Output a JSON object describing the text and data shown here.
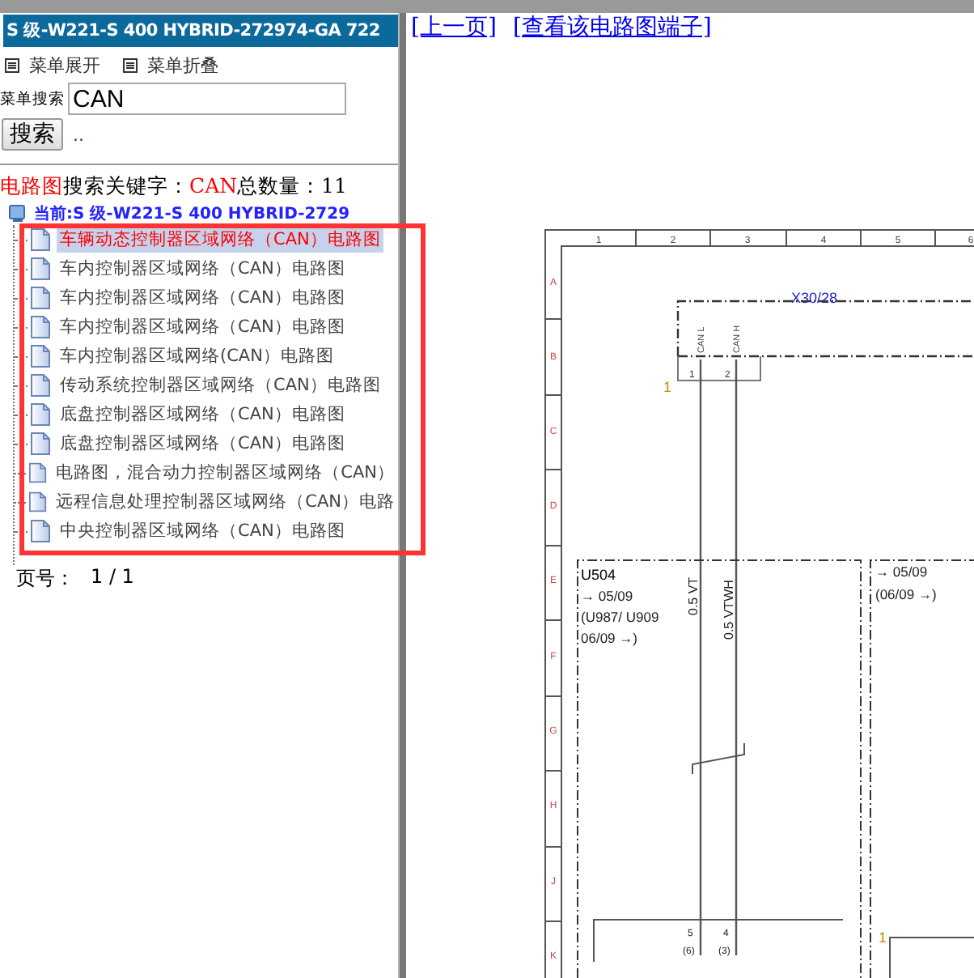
{
  "title_bar": {
    "title": "S 级-W221-S 400 HYBRID-272974-GA 722"
  },
  "menu_toggles": [
    {
      "label": "菜单展开"
    },
    {
      "label": "菜单折叠"
    }
  ],
  "search": {
    "label": "菜单搜索",
    "value": "CAN",
    "button": "搜索",
    "extra": ".."
  },
  "result_summary": {
    "category": "电路图",
    "keyword_label": "搜索关键字：",
    "keyword": "CAN",
    "count_label": "总数量：",
    "count": "11"
  },
  "tree": {
    "label": "当前:S 级-W221-S 400 HYBRID-2729",
    "children": [
      {
        "label": "车辆动态控制器区域网络（CAN）电路图",
        "selected": true
      },
      {
        "label": "车内控制器区域网络（CAN）电路图",
        "selected": false
      },
      {
        "label": "车内控制器区域网络（CAN）电路图",
        "selected": false
      },
      {
        "label": "车内控制器区域网络（CAN）电路图",
        "selected": false
      },
      {
        "label": "车内控制器区域网络(CAN）电路图",
        "selected": false
      },
      {
        "label": "传动系统控制器区域网络（CAN）电路图",
        "selected": false
      },
      {
        "label": "底盘控制器区域网络（CAN）电路图",
        "selected": false
      },
      {
        "label": "底盘控制器区域网络（CAN）电路图",
        "selected": false
      },
      {
        "label": "电路图，混合动力控制器区域网络（CAN）",
        "selected": false
      },
      {
        "label": "远程信息处理控制器区域网络（CAN）电路",
        "selected": false
      },
      {
        "label": "中央控制器区域网络（CAN）电路图",
        "selected": false
      }
    ]
  },
  "pager": {
    "label": "页号：",
    "value": "1 / 1"
  },
  "nav_links": [
    {
      "label": "[上一页]"
    },
    {
      "label": "[查看该电路图端子]"
    }
  ],
  "diagram": {
    "column_labels": [
      "1",
      "2",
      "3",
      "4",
      "5",
      "6"
    ],
    "row_labels": [
      "A",
      "B",
      "C",
      "D",
      "E",
      "F",
      "G",
      "H",
      "J",
      "K"
    ],
    "connector": "X30/28",
    "connector_ref": "1",
    "pins": [
      {
        "signal": "CAN L",
        "number": "1"
      },
      {
        "signal": "CAN H",
        "number": "2"
      }
    ],
    "wires": [
      {
        "label": "0.5 VT",
        "end_pin": "5",
        "end_alt": "(6)"
      },
      {
        "label": "0.5 VTWH",
        "end_pin": "4",
        "end_alt": "(3)"
      }
    ],
    "module": {
      "name": "U504",
      "lines": [
        "→ 05/09",
        "(U987/ U909",
        "06/09 →)"
      ]
    },
    "side_module": {
      "lines": [
        "→ 05/09",
        "(06/09 →)"
      ]
    },
    "side_ref": "1"
  }
}
